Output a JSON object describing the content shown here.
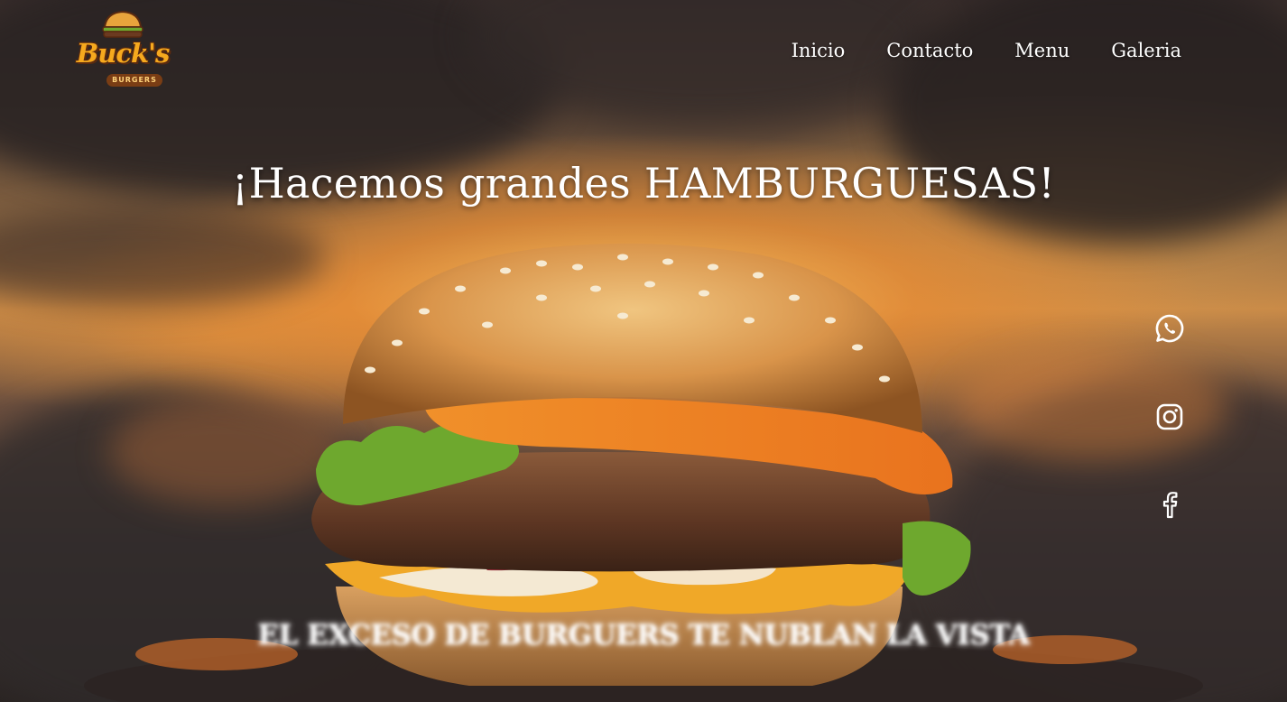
{
  "brand": {
    "logo_word": "Buck's",
    "logo_sub": "BURGERS"
  },
  "nav": {
    "items": [
      {
        "label": "Inicio"
      },
      {
        "label": "Contacto"
      },
      {
        "label": "Menu"
      },
      {
        "label": "Galeria"
      }
    ]
  },
  "hero": {
    "headline": "¡Hacemos grandes HAMBURGUESAS!",
    "tagline": "EL EXCESO DE BURGUERS TE NUBLAN LA VISTA"
  },
  "social": {
    "icons": [
      "whatsapp-icon",
      "instagram-icon",
      "facebook-icon"
    ]
  },
  "colors": {
    "text": "#ffffff",
    "logo_orange": "#f6a91e",
    "logo_brown": "#7a3d14",
    "sky_glow": "#e88c34"
  }
}
